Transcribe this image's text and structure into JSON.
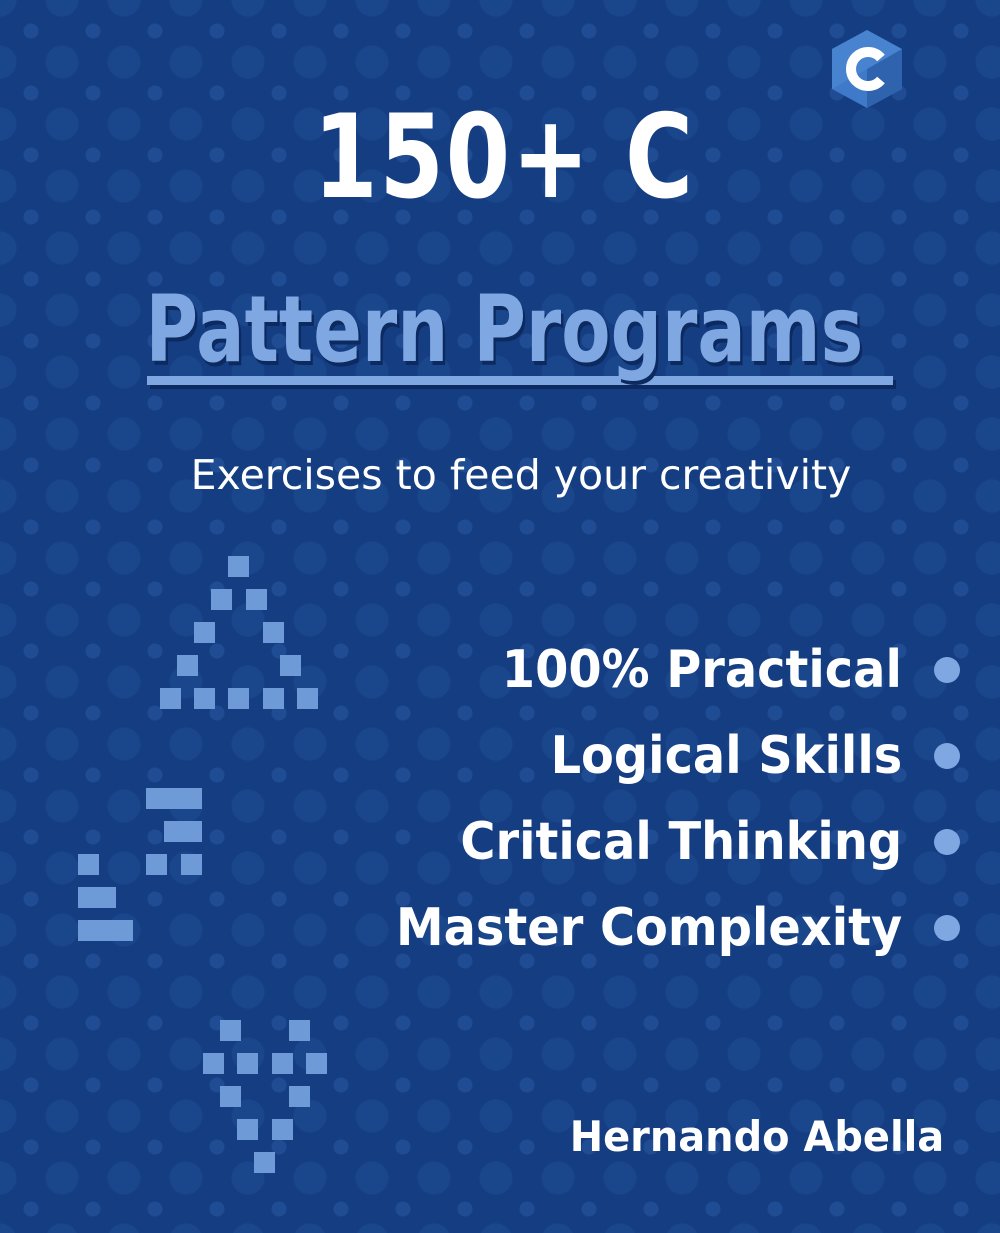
{
  "cover": {
    "title_line1": "150+ C",
    "title_line2": "Pattern Programs",
    "tagline": "Exercises to feed your creativity",
    "features": [
      "100% Practical",
      "Logical Skills",
      "Critical Thinking",
      "Master Complexity"
    ],
    "author": "Hernando Abella"
  },
  "logo": {
    "letter": "C",
    "icon": "c-language-hexagon-icon"
  },
  "colors": {
    "background": "#153d82",
    "accent": "#7fa7e2",
    "text": "#ffffff",
    "pattern_squares": "#6f9ad8"
  },
  "decorative_patterns": [
    {
      "name": "triangle-pattern",
      "rows": [
        "....#....",
        "...#.#...",
        "..#...#..",
        ".#.....#.",
        "#.#.#.#.#"
      ]
    },
    {
      "name": "staircase-pattern",
      "rows": [
        "....###",
        ".....##",
        "#...#.#",
        "##.....",
        "###...."
      ]
    },
    {
      "name": "inverted-triangle-pattern",
      "rows": [
        "..#...#..",
        ".#.#.#.#.",
        "..#...#..",
        "...#.#...",
        "....#...."
      ]
    }
  ]
}
